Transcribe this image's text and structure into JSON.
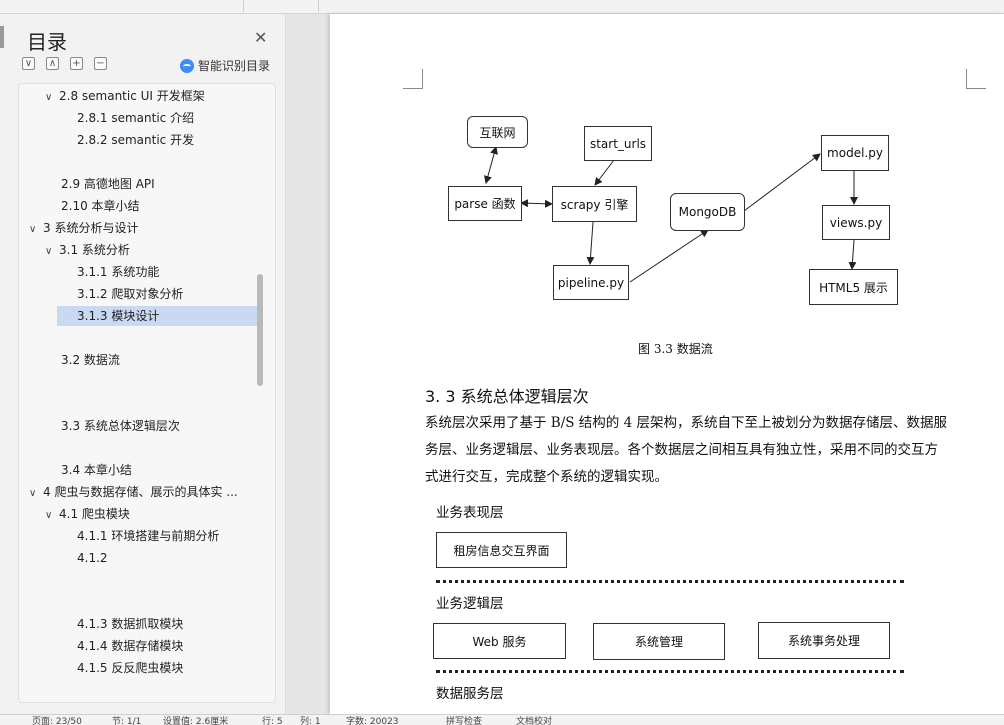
{
  "sidebar": {
    "title": "目录",
    "ai_button": "智能识别目录",
    "controls": [
      "expand-all",
      "collapse-all",
      "add",
      "remove"
    ],
    "items": [
      {
        "label": "2.8 semantic UI 开发框架",
        "level": 1,
        "expander": "v"
      },
      {
        "label": "2.8.1 semantic 介绍",
        "level": 2
      },
      {
        "label": "2.8.2 semantic 开发",
        "level": 2
      },
      {
        "label": "2.9  高德地图 API",
        "level": 1
      },
      {
        "label": "2.10  本章小结",
        "level": 1
      },
      {
        "label": "3  系统分析与设计",
        "level": 0,
        "expander": "v"
      },
      {
        "label": "3.1  系统分析",
        "level": 1,
        "expander": "v"
      },
      {
        "label": "3.1.1  系统功能",
        "level": 2
      },
      {
        "label": "3.1.2  爬取对象分析",
        "level": 2
      },
      {
        "label": "3.1.3  模块设计",
        "level": 2,
        "active": true
      },
      {
        "label": "3.2  数据流",
        "level": 1
      },
      {
        "label": "3.3  系统总体逻辑层次",
        "level": 1
      },
      {
        "label": "3.4  本章小结",
        "level": 1
      },
      {
        "label": "4  爬虫与数据存储、展示的具体实 ...",
        "level": 0,
        "expander": "v"
      },
      {
        "label": "4.1  爬虫模块",
        "level": 1,
        "expander": "v"
      },
      {
        "label": "4.1.1  环境搭建与前期分析",
        "level": 2
      },
      {
        "label": "4.1.2",
        "level": 2
      },
      {
        "label": "4.1.3  数据抓取模块",
        "level": 2
      },
      {
        "label": "4.1.4  数据存储模块",
        "level": 2
      },
      {
        "label": "4.1.5  反反爬虫模块",
        "level": 2
      }
    ]
  },
  "document": {
    "figure": {
      "nodes": {
        "internet": "互联网",
        "start_urls": "start_urls",
        "parse": "parse 函数",
        "scrapy": "scrapy 引擎",
        "mongodb": "MongoDB",
        "model": "model.py",
        "views": "views.py",
        "pipeline": "pipeline.py",
        "html5": "HTML5 展示"
      },
      "caption": "图 3.3  数据流"
    },
    "section_heading": "3. 3  系统总体逻辑层次",
    "paragraph_lines": [
      "系统层次采用了基于 B/S 结构的 4 层架构，系统自下至上被划分为数据存储层、数据服",
      "务层、业务逻辑层、业务表现层。各个数据层之间相互具有独立性，采用不同的交互方",
      "式进行交互，完成整个系统的逻辑实现。"
    ],
    "layers": {
      "presentation": {
        "label": "业务表现层",
        "boxes": [
          "租房信息交互界面"
        ]
      },
      "logic": {
        "label": "业务逻辑层",
        "boxes": [
          "Web 服务",
          "系统管理",
          "系统事务处理"
        ]
      },
      "data_service": {
        "label": "数据服务层"
      }
    }
  },
  "statusbar": {
    "items": [
      "页面: 23/50",
      "节: 1/1",
      "设置值: 2.6厘米",
      "行: 5",
      "列: 1",
      "字数: 20023",
      "拼写检查",
      "文档校对"
    ]
  },
  "colors": {
    "active_item": "#c9d9f2",
    "ai_icon": "#3c8ef0",
    "page": "#ffffff",
    "sidebar": "#f2f2f2"
  }
}
